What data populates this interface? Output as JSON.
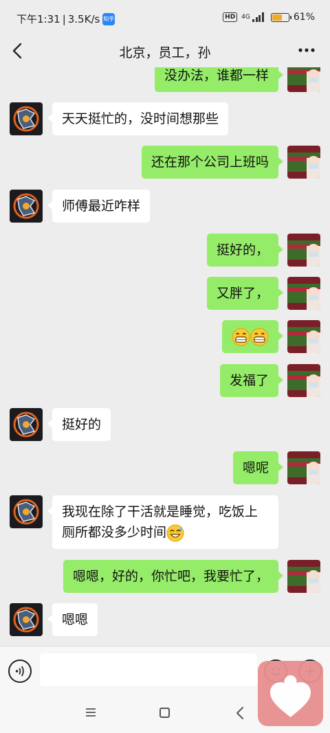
{
  "status_bar": {
    "time": "下午1:31",
    "separator": "|",
    "speed": "3.5K/s",
    "app_badge": "知乎",
    "hd": "HD",
    "network": "4G",
    "battery_level": 0.61,
    "battery_text": "61%"
  },
  "header": {
    "title": "北京，员工，孙"
  },
  "colors": {
    "background": "#ededed",
    "self_bubble": "#95ec69",
    "other_bubble": "#ffffff",
    "battery": "#f1a928"
  },
  "messages": [
    {
      "from": "self",
      "text": "没办法，谁都一样"
    },
    {
      "from": "other",
      "text": "天天挺忙的，没时间想那些"
    },
    {
      "from": "self",
      "text": "还在那个公司上班吗"
    },
    {
      "from": "other",
      "text": "师傅最近咋样"
    },
    {
      "from": "self",
      "text": "挺好的，"
    },
    {
      "from": "self",
      "text": "又胖了，"
    },
    {
      "from": "self",
      "text": "",
      "emoji": [
        "grin-icon",
        "grin-icon"
      ]
    },
    {
      "from": "self",
      "text": "发福了"
    },
    {
      "from": "other",
      "text": "挺好的"
    },
    {
      "from": "self",
      "text": "嗯呢"
    },
    {
      "from": "other",
      "text": "我现在除了干活就是睡觉，吃饭上厕所都没多少时间",
      "emoji": [
        "sweat-smile-icon"
      ]
    },
    {
      "from": "self",
      "text": "嗯嗯，好的，你忙吧，我要忙了，"
    },
    {
      "from": "other",
      "text": "嗯嗯"
    }
  ]
}
